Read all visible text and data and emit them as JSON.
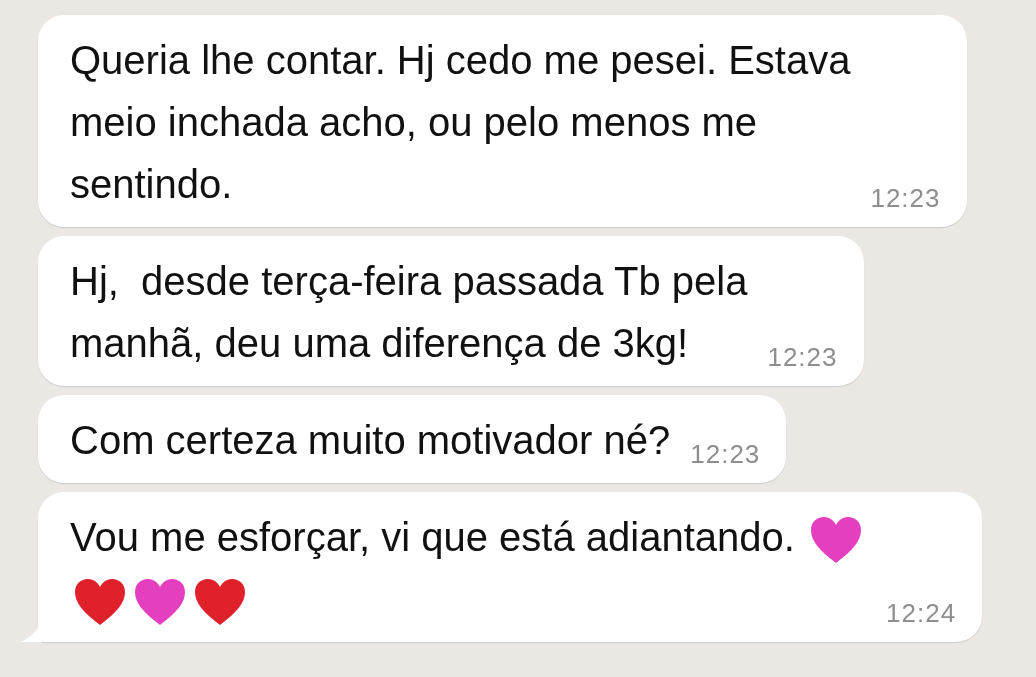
{
  "messages": [
    {
      "text": "Queria lhe contar. Hj cedo me pesei. Estava\nmeio inchada acho, ou pelo menos me\nsentindo.",
      "time": "12:23",
      "tail": false
    },
    {
      "text": "Hj,  desde terça-feira passada Tb pela\nmanhã, deu uma diferença de 3kg!",
      "time": "12:23",
      "tail": false
    },
    {
      "text": "Com certeza muito motivador né?",
      "time": "12:23",
      "tail": false
    },
    {
      "text": "Vou me esforçar, vi que está adiantando.",
      "time": "12:24",
      "tail": true,
      "heart_lines": [
        [
          {
            "color": "#e43fbf"
          }
        ],
        [
          {
            "color": "#e0202a"
          },
          {
            "color": "#e43fbf"
          },
          {
            "color": "#e0202a"
          }
        ]
      ]
    }
  ]
}
